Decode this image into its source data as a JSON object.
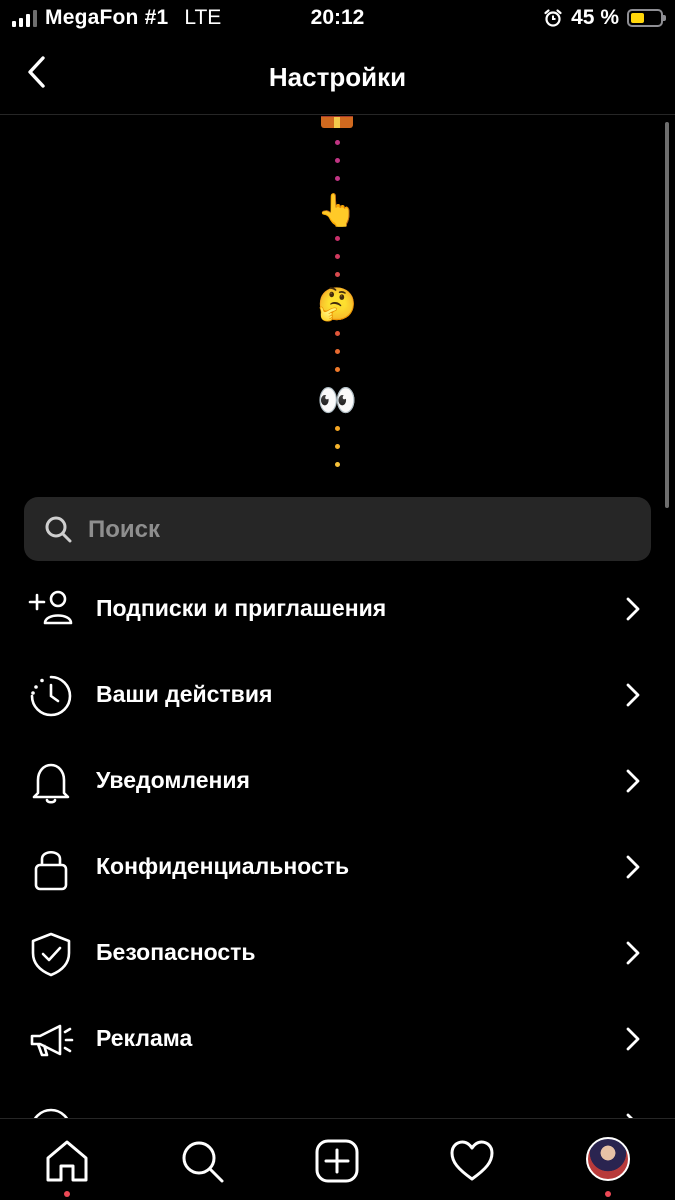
{
  "status_bar": {
    "carrier": "MegaFon #1",
    "network": "LTE",
    "time": "20:12",
    "battery_text": "45 %",
    "battery_level": 0.45,
    "battery_color": "#ffd60a"
  },
  "header": {
    "title": "Настройки",
    "back_icon": "chevron-left-icon"
  },
  "emoji_chain": [
    "👆",
    "🤔",
    "👀"
  ],
  "search": {
    "placeholder": "Поиск",
    "icon": "search-icon"
  },
  "menu": {
    "items": [
      {
        "label": "Подписки и приглашения",
        "icon": "add-person-icon"
      },
      {
        "label": "Ваши действия",
        "icon": "activity-clock-icon"
      },
      {
        "label": "Уведомления",
        "icon": "bell-icon"
      },
      {
        "label": "Конфиденциальность",
        "icon": "lock-icon"
      },
      {
        "label": "Безопасность",
        "icon": "shield-check-icon"
      },
      {
        "label": "Реклама",
        "icon": "megaphone-icon"
      }
    ]
  },
  "tab_bar": {
    "tabs": [
      {
        "name": "home",
        "icon": "home-icon",
        "active": true
      },
      {
        "name": "search",
        "icon": "search-icon"
      },
      {
        "name": "create",
        "icon": "add-post-icon"
      },
      {
        "name": "activity",
        "icon": "heart-icon"
      },
      {
        "name": "profile",
        "icon": "avatar"
      }
    ],
    "notification_dot_color": "#ed4956"
  },
  "colors": {
    "background": "#000000",
    "surface": "#262626",
    "text_primary": "#ffffff",
    "text_secondary": "#8e8e8e"
  }
}
